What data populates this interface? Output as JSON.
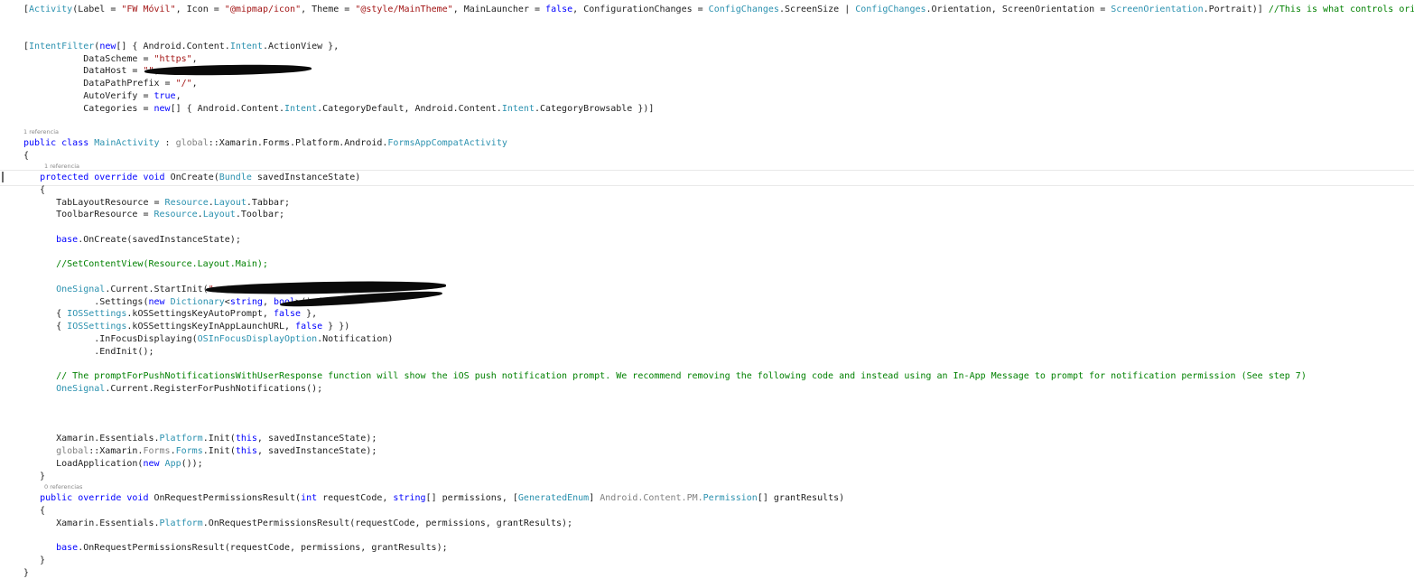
{
  "editor": {
    "code_lens": {
      "class_refs": "1 referencia",
      "oncreate_refs": "1 referencia",
      "permissions_refs": "0 referencias"
    },
    "lines": [
      [
        [
          "[",
          ""
        ],
        [
          "Activity",
          "ty"
        ],
        [
          "(Label = ",
          ""
        ],
        [
          "\"FW Móvil\"",
          "st"
        ],
        [
          ", Icon = ",
          ""
        ],
        [
          "\"@mipmap/icon\"",
          "st"
        ],
        [
          ", Theme = ",
          ""
        ],
        [
          "\"@style/MainTheme\"",
          "st"
        ],
        [
          ", MainLauncher = ",
          ""
        ],
        [
          "false",
          "kw"
        ],
        [
          ", ConfigurationChanges = ",
          ""
        ],
        [
          "ConfigChanges",
          "ty"
        ],
        [
          ".ScreenSize | ",
          ""
        ],
        [
          "ConfigChanges",
          "ty"
        ],
        [
          ".Orientation, ScreenOrientation = ",
          ""
        ],
        [
          "ScreenOrientation",
          "ty"
        ],
        [
          ".Portrait)] ",
          ""
        ],
        [
          "//This is what controls orientation",
          "cm"
        ]
      ],
      [
        [
          "[",
          ""
        ],
        [
          "IntentFilter",
          "ty"
        ],
        [
          "(",
          ""
        ],
        [
          "new",
          "kw"
        ],
        [
          "[] { Android.Content.",
          ""
        ],
        [
          "Intent",
          "ty"
        ],
        [
          ".ActionView },",
          ""
        ]
      ],
      [
        [
          "           DataScheme = ",
          ""
        ],
        [
          "\"https\"",
          "st"
        ],
        [
          ",",
          ""
        ]
      ],
      [
        [
          "           DataHost = ",
          ""
        ],
        [
          "\"\"",
          "st"
        ],
        [
          ",",
          ""
        ]
      ],
      [
        [
          "           DataPathPrefix = ",
          ""
        ],
        [
          "\"/\"",
          "st"
        ],
        [
          ",",
          ""
        ]
      ],
      [
        [
          "           AutoVerify = ",
          ""
        ],
        [
          "true",
          "kw"
        ],
        [
          ",",
          ""
        ]
      ],
      [
        [
          "           Categories = ",
          ""
        ],
        [
          "new",
          "kw"
        ],
        [
          "[] { Android.Content.",
          ""
        ],
        [
          "Intent",
          "ty"
        ],
        [
          ".CategoryDefault, Android.Content.",
          ""
        ],
        [
          "Intent",
          "ty"
        ],
        [
          ".CategoryBrowsable })]",
          ""
        ]
      ],
      [
        [
          "public class ",
          "kw"
        ],
        [
          "MainActivity",
          "ty"
        ],
        [
          " : ",
          ""
        ],
        [
          "global",
          "gr"
        ],
        [
          "::Xamarin.Forms.Platform.Android.",
          ""
        ],
        [
          "FormsAppCompatActivity",
          "ty"
        ]
      ],
      [
        [
          "{",
          ""
        ]
      ],
      [
        [
          "   ",
          ""
        ],
        [
          "protected override void ",
          "kw"
        ],
        [
          "OnCreate(",
          ""
        ],
        [
          "Bundle",
          "ty"
        ],
        [
          " savedInstanceState)",
          ""
        ]
      ],
      [
        [
          "   {",
          ""
        ]
      ],
      [
        [
          "      TabLayoutResource = ",
          ""
        ],
        [
          "Resource",
          "ty"
        ],
        [
          ".",
          ""
        ],
        [
          "Layout",
          "ty"
        ],
        [
          ".Tabbar;",
          ""
        ]
      ],
      [
        [
          "      ToolbarResource = ",
          ""
        ],
        [
          "Resource",
          "ty"
        ],
        [
          ".",
          ""
        ],
        [
          "Layout",
          "ty"
        ],
        [
          ".Toolbar;",
          ""
        ]
      ],
      [
        [
          "      ",
          ""
        ],
        [
          "base",
          "kw"
        ],
        [
          ".OnCreate(savedInstanceState);",
          ""
        ]
      ],
      [
        [
          "      ",
          ""
        ],
        [
          "//SetContentView(Resource.Layout.Main);",
          "cm"
        ]
      ],
      [
        [
          "      ",
          ""
        ],
        [
          "OneSignal",
          "ty"
        ],
        [
          ".Current.StartInit(",
          ""
        ],
        [
          "\"",
          "st"
        ]
      ],
      [
        [
          "             .Settings(",
          ""
        ],
        [
          "new ",
          "kw"
        ],
        [
          "Dictionary",
          "ty"
        ],
        [
          "<",
          ""
        ],
        [
          "string",
          "kw"
        ],
        [
          ", ",
          ""
        ],
        [
          "bool",
          "kw"
        ],
        [
          ">() {",
          ""
        ]
      ],
      [
        [
          "      { ",
          ""
        ],
        [
          "IOSSettings",
          "ty"
        ],
        [
          ".kOSSettingsKeyAutoPrompt, ",
          ""
        ],
        [
          "false",
          "kw"
        ],
        [
          " },",
          ""
        ]
      ],
      [
        [
          "      { ",
          ""
        ],
        [
          "IOSSettings",
          "ty"
        ],
        [
          ".kOSSettingsKeyInAppLaunchURL, ",
          ""
        ],
        [
          "false",
          "kw"
        ],
        [
          " } })",
          ""
        ]
      ],
      [
        [
          "             .InFocusDisplaying(",
          ""
        ],
        [
          "OSInFocusDisplayOption",
          "ty"
        ],
        [
          ".Notification)",
          ""
        ]
      ],
      [
        [
          "             .EndInit();",
          ""
        ]
      ],
      [
        [
          "      ",
          ""
        ],
        [
          "// The promptForPushNotificationsWithUserResponse function will show the iOS push notification prompt. We recommend removing the following code and instead using an In-App Message to prompt for notification permission (See step 7)",
          "cm"
        ]
      ],
      [
        [
          "      ",
          ""
        ],
        [
          "OneSignal",
          "ty"
        ],
        [
          ".Current.RegisterForPushNotifications();",
          ""
        ]
      ],
      [
        [
          "      Xamarin.Essentials.",
          ""
        ],
        [
          "Platform",
          "ty"
        ],
        [
          ".Init(",
          ""
        ],
        [
          "this",
          "kw"
        ],
        [
          ", savedInstanceState);",
          ""
        ]
      ],
      [
        [
          "      ",
          ""
        ],
        [
          "global",
          "gr"
        ],
        [
          "::Xamarin.",
          ""
        ],
        [
          "Forms",
          "gr"
        ],
        [
          ".",
          ""
        ],
        [
          "Forms",
          "ty"
        ],
        [
          ".Init(",
          ""
        ],
        [
          "this",
          "kw"
        ],
        [
          ", savedInstanceState);",
          ""
        ]
      ],
      [
        [
          "      LoadApplication(",
          ""
        ],
        [
          "new ",
          "kw"
        ],
        [
          "App",
          "ty"
        ],
        [
          "());",
          ""
        ]
      ],
      [
        [
          "   }",
          ""
        ]
      ],
      [
        [
          "   ",
          ""
        ],
        [
          "public override void ",
          "kw"
        ],
        [
          "OnRequestPermissionsResult(",
          ""
        ],
        [
          "int",
          "kw"
        ],
        [
          " requestCode, ",
          ""
        ],
        [
          "string",
          "kw"
        ],
        [
          "[] permissions, [",
          ""
        ],
        [
          "GeneratedEnum",
          "ty"
        ],
        [
          "] ",
          ""
        ],
        [
          "Android.Content.PM.",
          "gr"
        ],
        [
          "Permission",
          "ty"
        ],
        [
          "[] grantResults)",
          ""
        ]
      ],
      [
        [
          "   {",
          ""
        ]
      ],
      [
        [
          "      Xamarin.Essentials.",
          ""
        ],
        [
          "Platform",
          "ty"
        ],
        [
          ".OnRequestPermissionsResult(requestCode, permissions, grantResults);",
          ""
        ]
      ],
      [
        [
          "      ",
          ""
        ],
        [
          "base",
          "kw"
        ],
        [
          ".OnRequestPermissionsResult(requestCode, permissions, grantResults);",
          ""
        ]
      ],
      [
        [
          "   }",
          ""
        ]
      ],
      [
        [
          "}",
          ""
        ]
      ]
    ]
  }
}
